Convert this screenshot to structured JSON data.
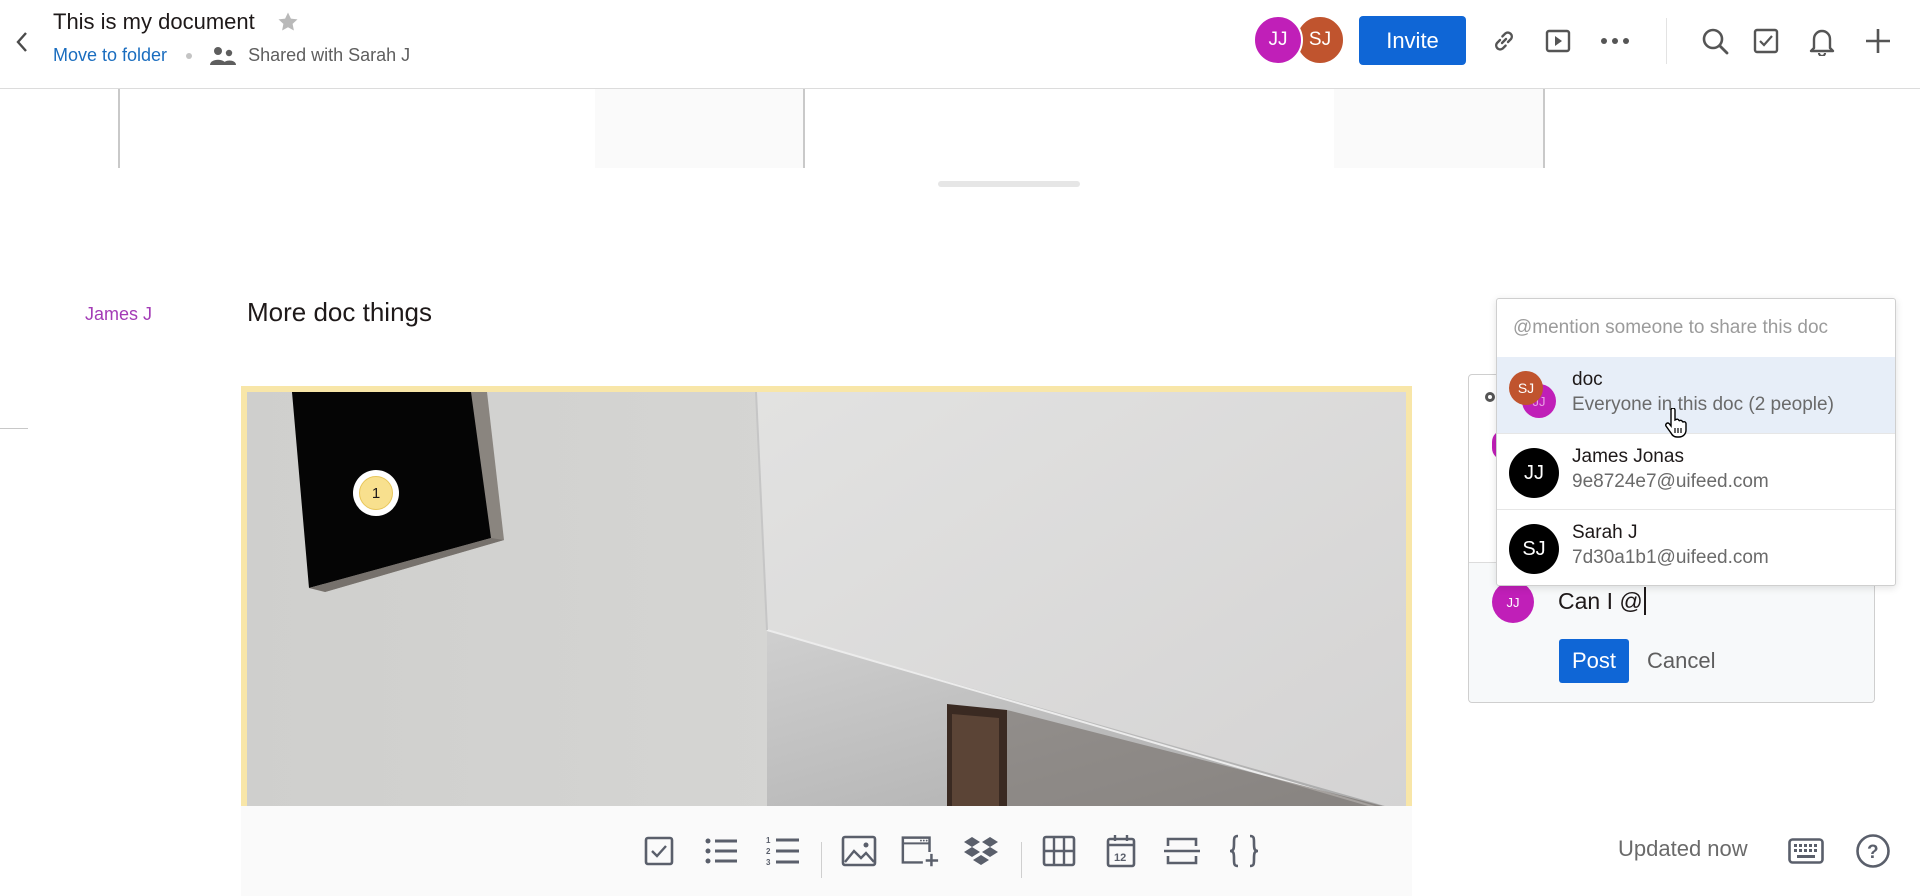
{
  "header": {
    "title": "This is my document",
    "move_to_folder": "Move to folder",
    "shared_with": "Shared with Sarah J",
    "collaborators": [
      {
        "initials": "JJ",
        "color": "#c01fb8"
      },
      {
        "initials": "SJ",
        "color": "#c0542e"
      }
    ],
    "invite_label": "Invite",
    "accent": "#0f66d6"
  },
  "document": {
    "author": "James J",
    "heading": "More doc things",
    "annotation_number": "1"
  },
  "toolbar": {
    "tools": [
      "checklist",
      "bulleted-list",
      "numbered-list",
      "image",
      "embed",
      "dropbox",
      "table",
      "date",
      "divider",
      "code"
    ],
    "status": "Updated now"
  },
  "comment": {
    "author_initials": "JJ",
    "input_value": "Can I @",
    "post_label": "Post",
    "cancel_label": "Cancel"
  },
  "mention_menu": {
    "hint": "@mention someone to share this doc",
    "items": [
      {
        "name": "doc",
        "detail": "Everyone in this doc (2 people)",
        "initials": "SJ",
        "secondary_initials": "JJ",
        "active": true
      },
      {
        "name": "James Jonas",
        "detail": "9e8724e7@uifeed.com",
        "initials": "JJ",
        "active": false
      },
      {
        "name": "Sarah J",
        "detail": "7d30a1b1@uifeed.com",
        "initials": "SJ",
        "active": false
      }
    ]
  }
}
